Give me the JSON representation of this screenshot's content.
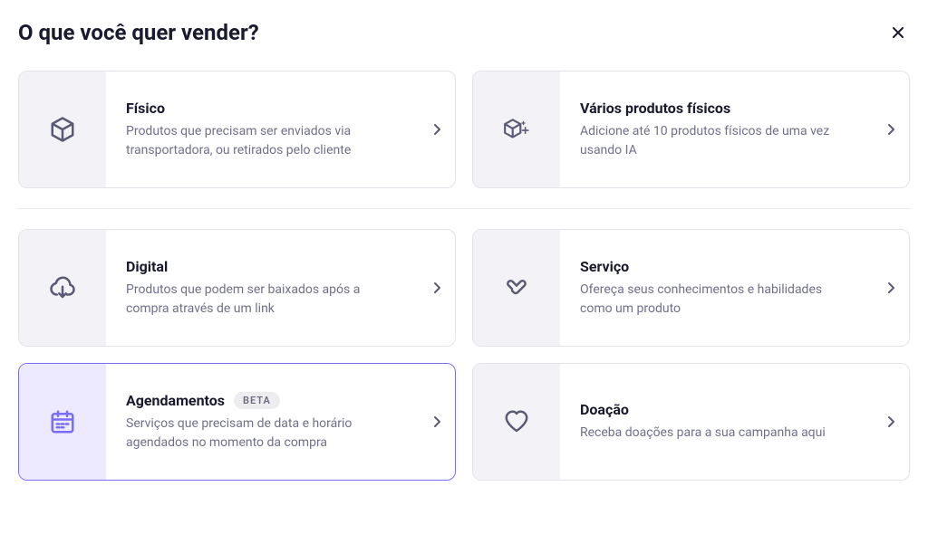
{
  "title": "O que você quer vender?",
  "badges": {
    "beta": "BETA"
  },
  "options": [
    {
      "key": "fisico",
      "title": "Físico",
      "desc": "Produtos que precisam ser enviados via transportadora, ou retirados pelo cliente",
      "icon": "box-icon",
      "highlight": false
    },
    {
      "key": "varios-fisicos",
      "title": "Vários produtos físicos",
      "desc": "Adicione até 10 produtos físicos de uma vez usando IA",
      "icon": "box-sparkle-icon",
      "highlight": false
    },
    {
      "key": "digital",
      "title": "Digital",
      "desc": "Produtos que podem ser baixados após a compra através de um link",
      "icon": "cloud-download-icon",
      "highlight": false
    },
    {
      "key": "servico",
      "title": "Serviço",
      "desc": "Ofereça seus conhecimentos e habilidades como um produto",
      "icon": "handshake-icon",
      "highlight": false
    },
    {
      "key": "agendamentos",
      "title": "Agendamentos",
      "desc": "Serviços que precisam de data e horário agendados no momento da compra",
      "icon": "calendar-icon",
      "highlight": true,
      "badge": "beta"
    },
    {
      "key": "doacao",
      "title": "Doação",
      "desc": "Receba doações para a sua campanha aqui",
      "icon": "heart-icon",
      "highlight": false
    }
  ]
}
